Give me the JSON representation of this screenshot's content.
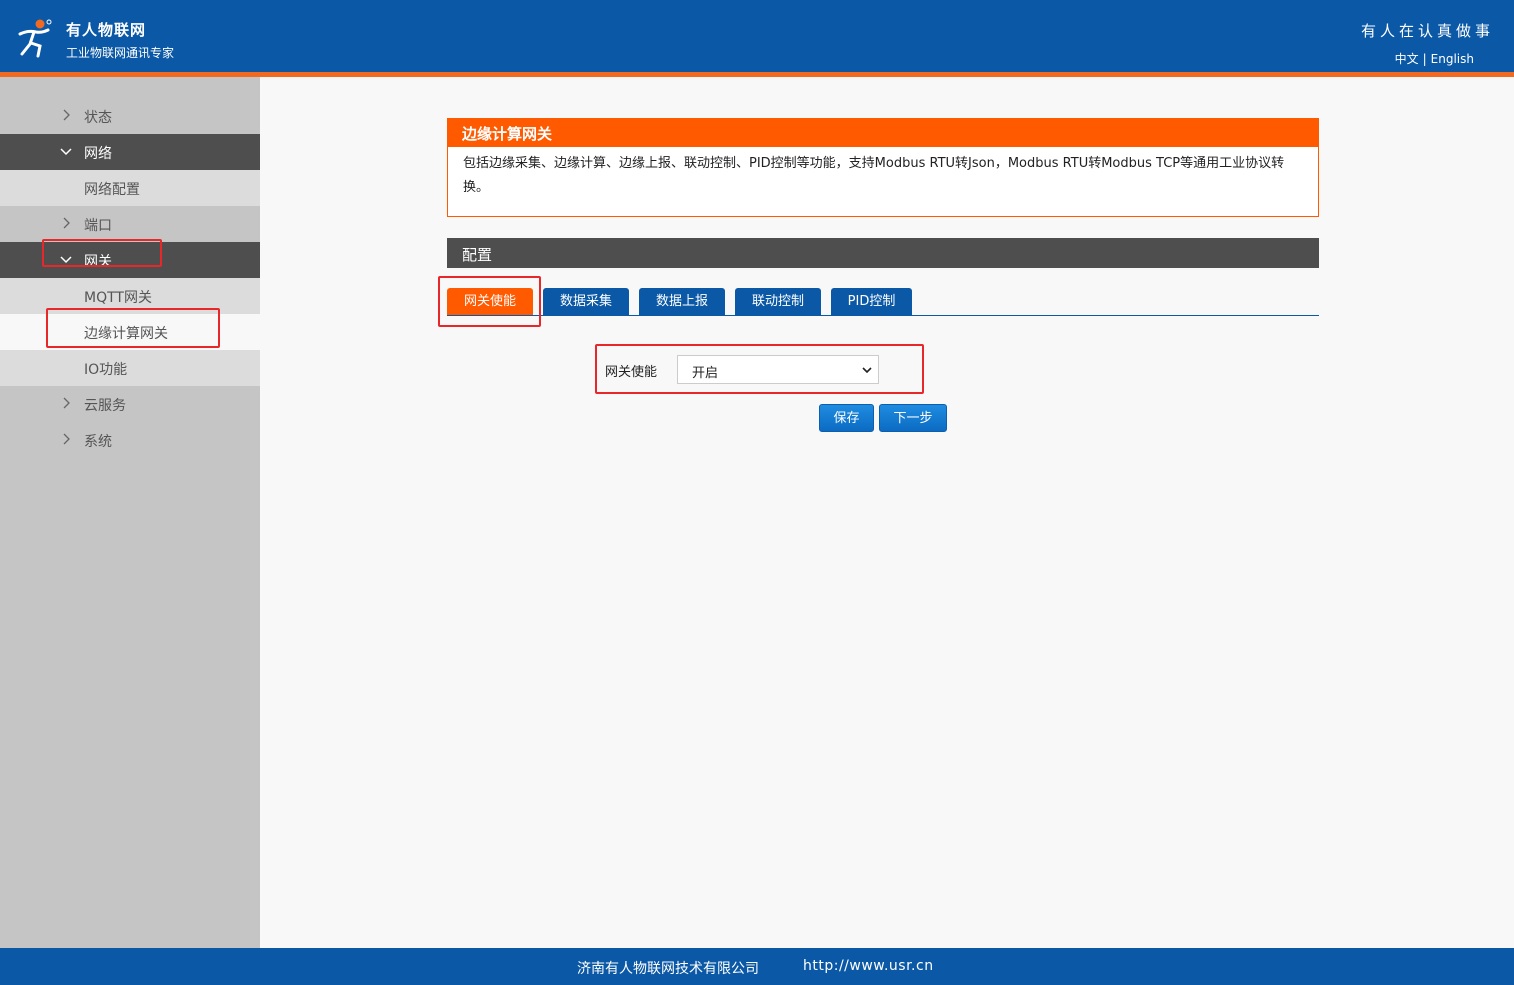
{
  "header": {
    "brand_name": "有人物联网",
    "brand_slogan": "工业物联网通讯专家",
    "motto": "有人在认真做事",
    "lang_zh": "中文",
    "lang_sep": "|",
    "lang_en": "English",
    "logo_icon": "usr-logo-icon"
  },
  "sidebar": {
    "items": [
      {
        "label": "状态"
      },
      {
        "label": "网络"
      },
      {
        "label": "网络配置"
      },
      {
        "label": "端口"
      },
      {
        "label": "网关"
      },
      {
        "label": "MQTT网关"
      },
      {
        "label": "边缘计算网关"
      },
      {
        "label": "IO功能"
      },
      {
        "label": "云服务"
      },
      {
        "label": "系统"
      }
    ]
  },
  "panel": {
    "title": "边缘计算网关",
    "description": "包括边缘采集、边缘计算、边缘上报、联动控制、PID控制等功能，支持Modbus RTU转Json，Modbus RTU转Modbus TCP等通用工业协议转换。"
  },
  "config": {
    "title": "配置",
    "tabs": [
      {
        "label": "网关使能"
      },
      {
        "label": "数据采集"
      },
      {
        "label": "数据上报"
      },
      {
        "label": "联动控制"
      },
      {
        "label": "PID控制"
      }
    ],
    "field_label": "网关使能",
    "field_value": "开启",
    "save_label": "保存",
    "next_label": "下一步"
  },
  "footer": {
    "company": "济南有人物联网技术有限公司",
    "url": "http://www.usr.cn"
  },
  "colors": {
    "brand_blue": "#0b58a6",
    "accent_orange": "#ff5a00",
    "highlight_red": "#e8272a"
  }
}
